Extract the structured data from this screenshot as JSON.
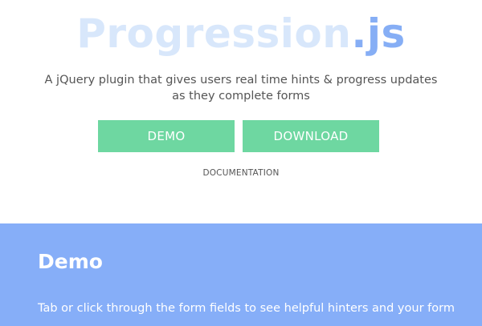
{
  "header": {
    "logo_main": "Progression",
    "logo_ext": ".js",
    "tagline": "A jQuery plugin that gives users real time hints & progress updates as they complete forms"
  },
  "actions": {
    "demo_label": "DEMO",
    "download_label": "DOWNLOAD",
    "documentation_label": "DOCUMENTATION"
  },
  "demo_section": {
    "title": "Demo",
    "description": "Tab or click through the form fields to see helpful hinters and your form"
  },
  "colors": {
    "accent_green": "#6ed7a1",
    "accent_blue": "#86aef8",
    "logo_light": "#d8e7fb"
  }
}
